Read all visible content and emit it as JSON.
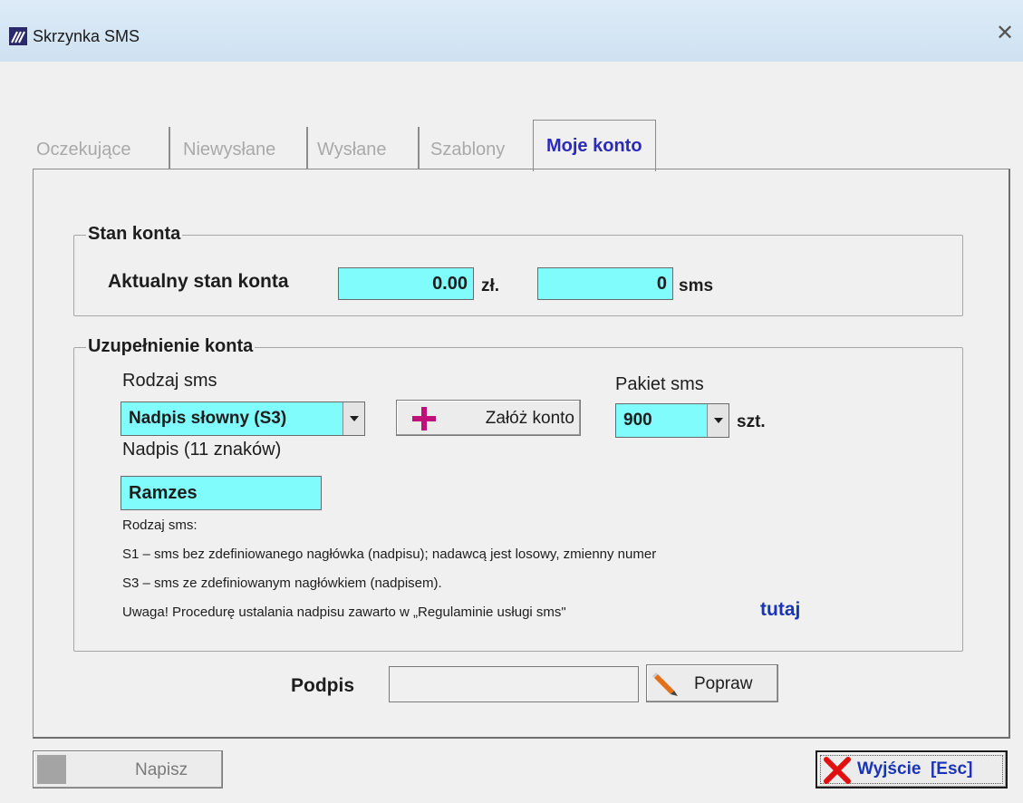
{
  "window": {
    "title": "Skrzynka SMS",
    "close_glyph": "✕"
  },
  "tabs": [
    {
      "label": "Oczekujące"
    },
    {
      "label": "Niewysłane"
    },
    {
      "label": "Wysłane"
    },
    {
      "label": "Szablony"
    },
    {
      "label": "Moje konto"
    }
  ],
  "stan_konta": {
    "legend": "Stan konta",
    "label": "Aktualny stan konta",
    "amount": "0.00",
    "currency": "zł.",
    "sms_count": "0",
    "sms_unit": "sms"
  },
  "uzupelnienie": {
    "legend": "Uzupełnienie konta",
    "rodzaj_label": "Rodzaj sms",
    "rodzaj_value": "Nadpis słowny (S3)",
    "zaloz_label": "Załóż konto",
    "pakiet_label": "Pakiet sms",
    "pakiet_value": "900",
    "pakiet_unit": "szt.",
    "nadpis_label": "Nadpis (11 znaków)",
    "nadpis_value": "Ramzes",
    "info_title": "Rodzaj sms:",
    "info_s1": "S1 –  sms bez zdefiniowanego nagłówka (nadpisu); nadawcą jest losowy, zmienny numer",
    "info_s3": "S3 –  sms ze zdefiniowanym nagłówkiem (nadpisem).",
    "uwaga": " Uwaga! Procedurę ustalania nadpisu zawarto w „Regulaminie usługi sms\"",
    "link": "tutaj"
  },
  "podpis": {
    "label": "Podpis",
    "value": "",
    "button": "Popraw"
  },
  "footer": {
    "napisz": "Napisz",
    "exit": "Wyjście  [Esc]"
  },
  "colors": {
    "field": "#80fcfc",
    "active_tab": "#2b2bb8",
    "link": "#1a34b8",
    "exit_x": "#e01010",
    "plus": "#c0107a"
  }
}
